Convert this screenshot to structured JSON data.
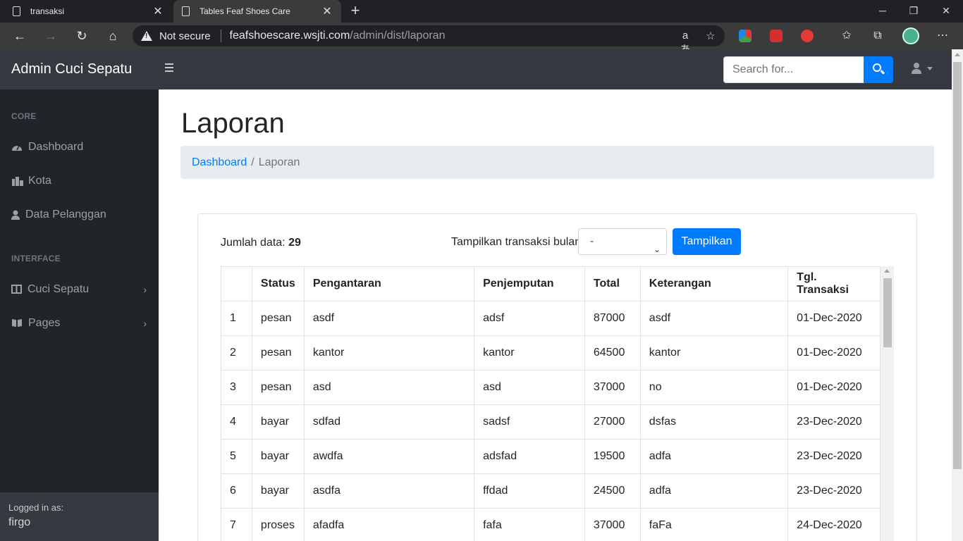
{
  "browser": {
    "tabs": [
      {
        "title": "transaksi",
        "active": false
      },
      {
        "title": "Tables Feaf Shoes Care",
        "active": true
      }
    ],
    "not_secure_label": "Not secure",
    "url_host": "feafshoescare.wsjti.com",
    "url_path": "/admin/dist/laporan"
  },
  "navbar": {
    "brand": "Admin Cuci Sepatu",
    "search_placeholder": "Search for..."
  },
  "sidebar": {
    "core_heading": "CORE",
    "core_items": [
      {
        "label": "Dashboard",
        "icon": "tachometer-icon"
      },
      {
        "label": "Kota",
        "icon": "city-icon"
      },
      {
        "label": "Data Pelanggan",
        "icon": "user-icon"
      }
    ],
    "interface_heading": "INTERFACE",
    "interface_items": [
      {
        "label": "Cuci Sepatu",
        "icon": "columns-icon"
      },
      {
        "label": "Pages",
        "icon": "book-icon"
      }
    ],
    "footer_label": "Logged in as:",
    "footer_user": "firgo"
  },
  "content": {
    "title": "Laporan",
    "breadcrumb": {
      "link": "Dashboard",
      "separator": "/",
      "active": "Laporan"
    },
    "jumlah_label": "Jumlah data:",
    "jumlah_value": "29",
    "filter_label": "Tampilkan transaksi bulan",
    "month_selected": "-",
    "show_button": "Tampilkan",
    "table": {
      "headers": [
        "",
        "Status",
        "Pengantaran",
        "Penjemputan",
        "Total",
        "Keterangan",
        "Tgl. Transaksi"
      ],
      "rows": [
        [
          "1",
          "pesan",
          "asdf",
          "adsf",
          "87000",
          "asdf",
          "01-Dec-2020"
        ],
        [
          "2",
          "pesan",
          "kantor",
          "kantor",
          "64500",
          "kantor",
          "01-Dec-2020"
        ],
        [
          "3",
          "pesan",
          "asd",
          "asd",
          "37000",
          "no",
          "01-Dec-2020"
        ],
        [
          "4",
          "bayar",
          "sdfad",
          "sadsf",
          "27000",
          "dsfas",
          "23-Dec-2020"
        ],
        [
          "5",
          "bayar",
          "awdfa",
          "adsfad",
          "19500",
          "adfa",
          "23-Dec-2020"
        ],
        [
          "6",
          "bayar",
          "asdfa",
          "ffdad",
          "24500",
          "adfa",
          "23-Dec-2020"
        ],
        [
          "7",
          "proses",
          "afadfa",
          "fafa",
          "37000",
          "faFa",
          "24-Dec-2020"
        ]
      ]
    }
  },
  "colors": {
    "primary": "#007bff",
    "navbar_bg": "#343a40",
    "sidebar_bg": "#212529"
  }
}
